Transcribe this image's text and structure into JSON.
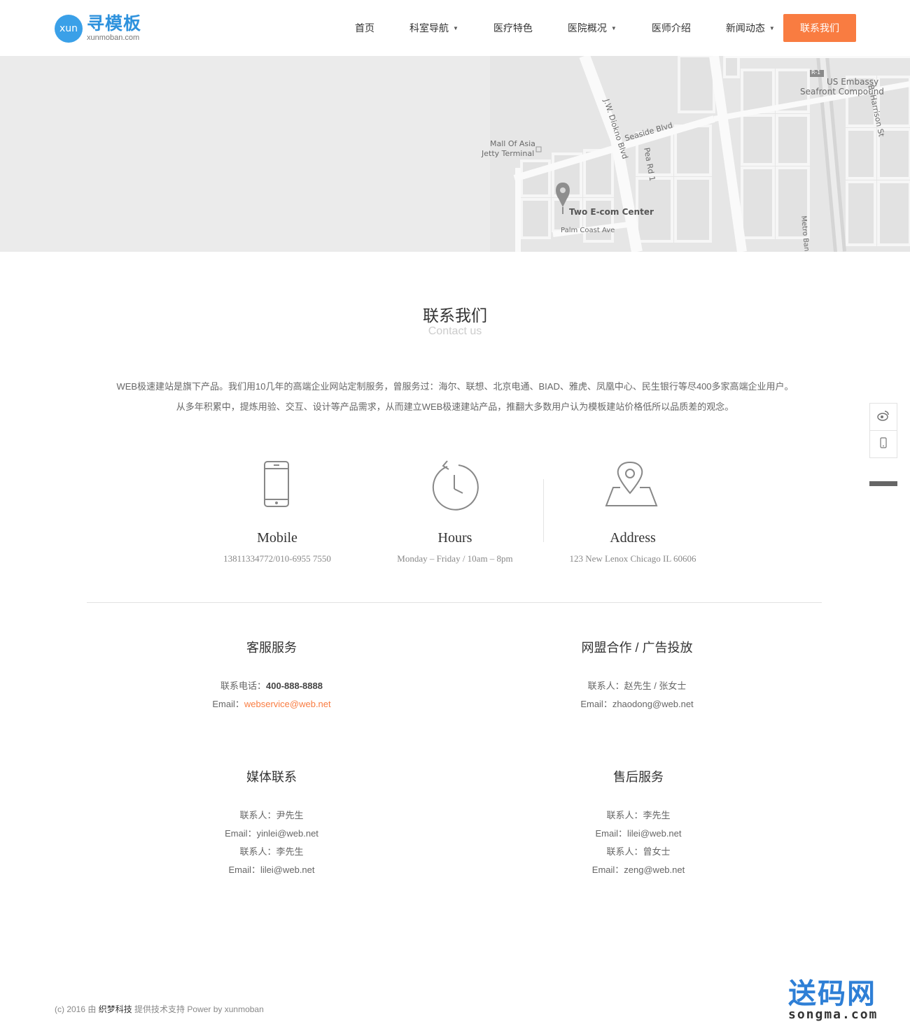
{
  "header": {
    "logo_mark": "xun",
    "logo_cn": "寻模板",
    "logo_en": "xunmoban.com",
    "nav": [
      {
        "label": "首页",
        "caret": ""
      },
      {
        "label": "科室导航",
        "caret": "▼"
      },
      {
        "label": "医疗特色",
        "caret": ""
      },
      {
        "label": "医院概况",
        "caret": "▼"
      },
      {
        "label": "医师介绍",
        "caret": ""
      },
      {
        "label": "新闻动态",
        "caret": "▼"
      }
    ],
    "cta_label": "联系我们",
    "cta_color": "#f97c41"
  },
  "map": {
    "labels": {
      "us_embassy": "US Embassy",
      "seafront": "Seafront Compound",
      "harrison": "B. Harrison St",
      "r1": "R-1",
      "diokno": "J.W. Diokno Blvd",
      "seaside": "Seaside Blvd",
      "mall_asia": "Mall Of Asia",
      "jetty": "Jetty Terminal",
      "pea": "Pea Rd 1",
      "two_ecom": "Two E-com Center",
      "palm": "Palm Coast Ave",
      "metro": "Metro Bank"
    }
  },
  "section": {
    "title_cn": "联系我们",
    "title_en": "Contact us",
    "intro_line1": "WEB极速建站是旗下产品。我们用10几年的高端企业网站定制服务，曾服务过：海尔、联想、北京电通、BIAD、雅虎、凤凰中心、民生银行等尽400多家高端企业用户。",
    "intro_line2": "从多年积累中，提炼用验、交互、设计等产品需求，从而建立WEB极速建站产品，推翻大多数用户认为模板建站价格低所以品质差的观念。"
  },
  "cards": [
    {
      "icon": "mobile-phone-icon",
      "title": "Mobile",
      "text": "13811334772/010-6955 7550"
    },
    {
      "icon": "clock-icon",
      "title": "Hours",
      "text": "Monday – Friday / 10am – 8pm"
    },
    {
      "icon": "map-pin-icon",
      "title": "Address",
      "text": "123  New Lenox  Chicago IL 60606"
    }
  ],
  "blocks": {
    "service": {
      "title": "客服服务",
      "phone_label": "联系电话：",
      "phone": "400-888-8888",
      "email_label": "Email：",
      "email": "webservice@web.net"
    },
    "alliance": {
      "title": "网盟合作 / 广告投放",
      "line1": "联系人：赵先生 / 张女士",
      "line2": "Email：zhaodong@web.net"
    },
    "media": {
      "title": "媒体联系",
      "line1": "联系人：尹先生",
      "line2": "Email：yinlei@web.net",
      "line3": "联系人：李先生",
      "line4": "Email：lilei@web.net"
    },
    "aftersale": {
      "title": "售后服务",
      "line1": "联系人：李先生",
      "line2": "Email：lilei@web.net",
      "line3": "联系人：曾女士",
      "line4": "Email：zeng@web.net"
    }
  },
  "side": {
    "weibo_icon": "weibo-icon",
    "mobile_icon": "mobile-icon"
  },
  "footer": {
    "prefix": "(c) 2016 由 ",
    "brand": "织梦科技",
    "suffix": " 提供技术支持 Power by xunmoban"
  },
  "watermark": {
    "cn": "送码网",
    "en": "songma.com"
  }
}
